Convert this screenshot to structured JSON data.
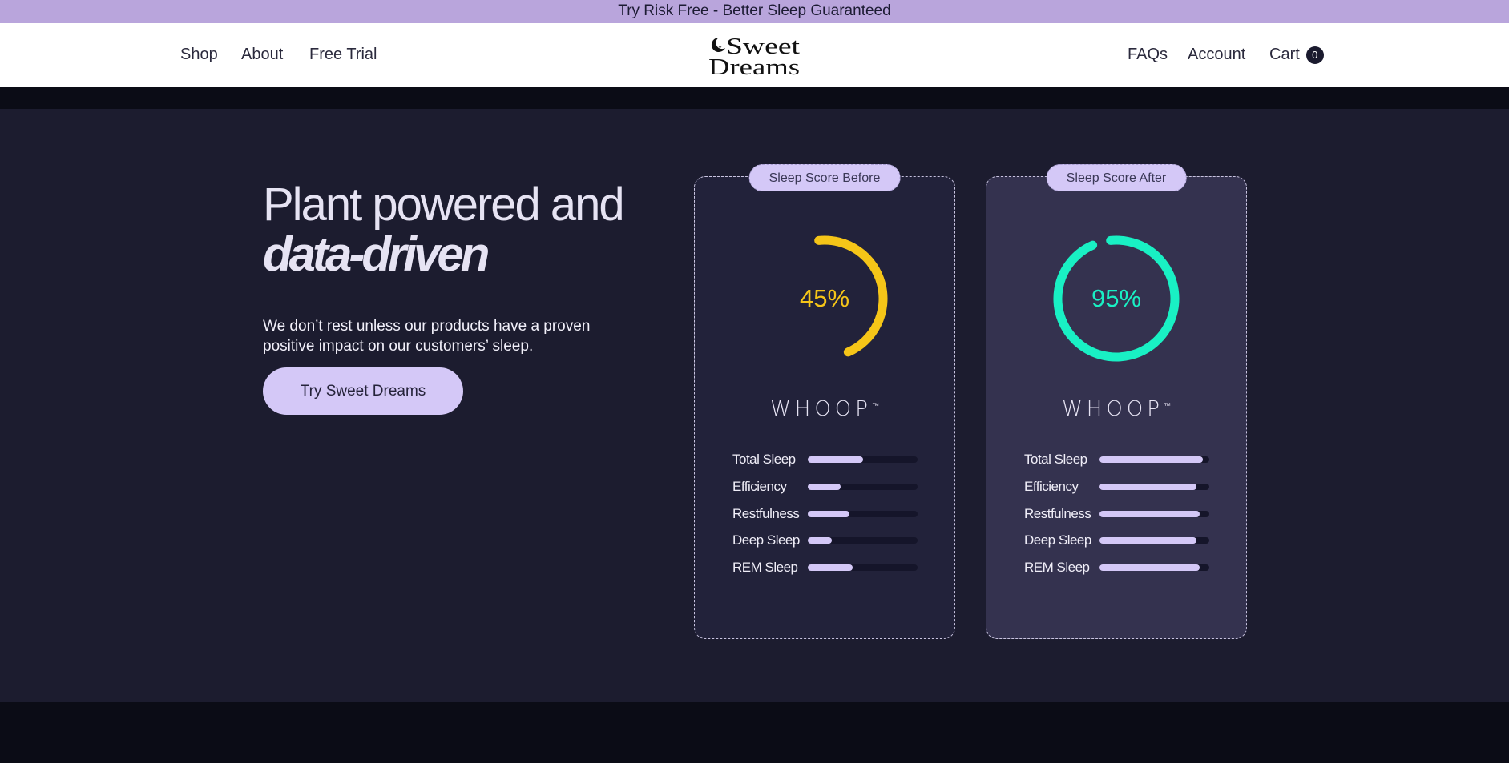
{
  "announcement": "Try Risk Free - Better Sleep Guaranteed",
  "nav": {
    "left": [
      "Shop",
      "About",
      "Free Trial"
    ],
    "right": [
      "FAQs",
      "Account"
    ],
    "cart_label": "Cart",
    "cart_count": "0"
  },
  "logo": {
    "line1": "Sweet",
    "line2": "Dreams"
  },
  "hero": {
    "heading_line1": "Plant powered and",
    "heading_line2": "data-driven",
    "subtext": "We don’t rest unless our products have a proven positive impact on our customers’ sleep.",
    "cta": "Try Sweet Dreams"
  },
  "cards": [
    {
      "pill": "Sleep Score Before",
      "score_label": "45%",
      "score": 0.45,
      "color": "#f5c518",
      "brand": "WHOOP",
      "metrics": [
        {
          "label": "Total Sleep",
          "value": 0.5
        },
        {
          "label": "Efficiency",
          "value": 0.3
        },
        {
          "label": "Restfulness",
          "value": 0.38
        },
        {
          "label": "Deep Sleep",
          "value": 0.22
        },
        {
          "label": "REM Sleep",
          "value": 0.41
        }
      ]
    },
    {
      "pill": "Sleep Score After",
      "score_label": "95%",
      "score": 0.95,
      "color": "#19f0c4",
      "brand": "WHOOP",
      "metrics": [
        {
          "label": "Total Sleep",
          "value": 0.94
        },
        {
          "label": "Efficiency",
          "value": 0.88
        },
        {
          "label": "Restfulness",
          "value": 0.91
        },
        {
          "label": "Deep Sleep",
          "value": 0.88
        },
        {
          "label": "REM Sleep",
          "value": 0.91
        }
      ]
    }
  ]
}
